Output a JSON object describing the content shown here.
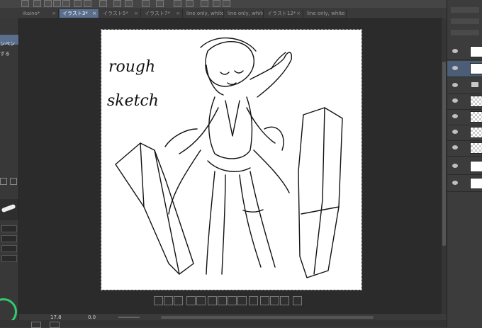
{
  "tabs": [
    {
      "label": "ikaino*",
      "active": false
    },
    {
      "label": "イラスト3*",
      "active": true
    },
    {
      "label": "イラスト5*",
      "active": false
    },
    {
      "label": "イラスト7*",
      "active": false
    },
    {
      "label": "line only, white",
      "active": false
    },
    {
      "label": "line only, white",
      "active": false
    },
    {
      "label": "イラスト12*",
      "active": false
    },
    {
      "label": "line only, white",
      "active": false
    }
  ],
  "left_panel": {
    "text_a": "ンペン",
    "text_b": "する"
  },
  "canvas": {
    "text_line1": "rough",
    "text_line2": "sketch"
  },
  "status": {
    "zoom": "17.8",
    "angle": "0.0"
  },
  "colors": {
    "accent_tab": "#5a6f8e",
    "canvas_bg": "#ffffff",
    "app_bg": "#2b2b2b"
  }
}
